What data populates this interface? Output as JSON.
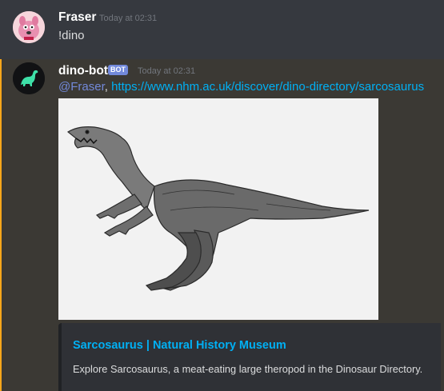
{
  "messages": [
    {
      "author": "Fraser",
      "timestamp": "Today at 02:31",
      "content": "!dino"
    },
    {
      "author": "dino-bot",
      "badge": "BOT",
      "timestamp": "Today at 02:31",
      "mention": "@Fraser",
      "separator": ",",
      "link": "https://www.nhm.ac.uk/discover/dino-directory/sarcosaurus",
      "embed": {
        "title": "Sarcosaurus | Natural History Museum",
        "description": "Explore Sarcosaurus, a meat-eating large theropod in the Dinosaur Directory."
      }
    }
  ],
  "colors": {
    "background": "#36393f",
    "highlight_bar": "#faa61a",
    "link": "#00b0f4",
    "mention": "#7289da",
    "bot_badge": "#7289da"
  },
  "icons": {
    "user_avatar": "pink-cartoon-dog-avatar-icon",
    "bot_avatar": "green-dinosaur-avatar-icon",
    "image": "sarcosaurus-illustration"
  }
}
